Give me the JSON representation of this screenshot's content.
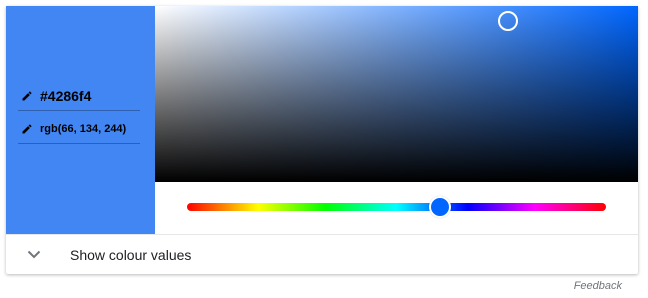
{
  "picker": {
    "selected_color": "#4286f4",
    "hue_color": "#0066ff",
    "hex_value": "#4286f4",
    "rgb_value": "rgb(66, 134, 244)",
    "hue_level": 0.605,
    "saturation": 0.73,
    "brightness": 0.957
  },
  "icons": {
    "hex_edit": "pencil-icon",
    "rgb_edit": "pencil-icon",
    "expand": "chevron-down-icon"
  },
  "footer": {
    "toggle_label": "Show colour values"
  },
  "feedback_label": "Feedback"
}
